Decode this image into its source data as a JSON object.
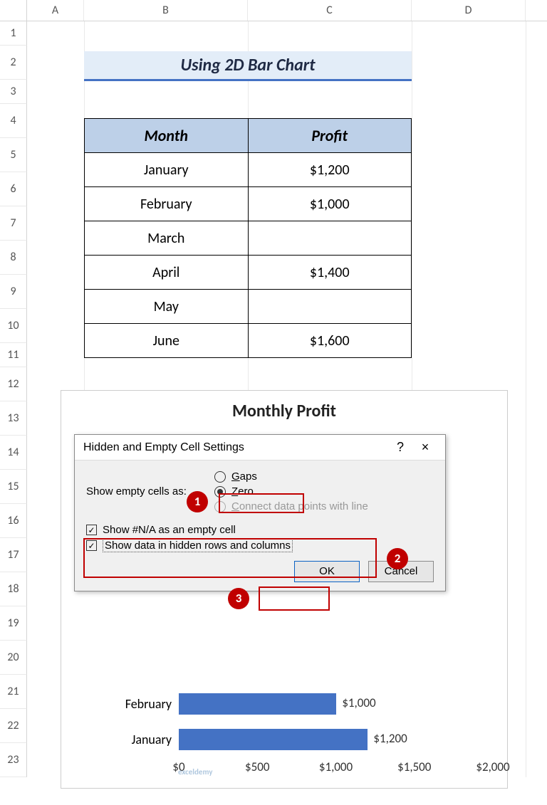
{
  "columns": [
    "A",
    "B",
    "C",
    "D"
  ],
  "rows": [
    "1",
    "2",
    "3",
    "4",
    "5",
    "6",
    "7",
    "8",
    "9",
    "10",
    "11",
    "12",
    "13",
    "14",
    "15",
    "16",
    "17",
    "18",
    "19",
    "20",
    "21",
    "22",
    "23"
  ],
  "title": "Using 2D Bar Chart",
  "table": {
    "headers": [
      "Month",
      "Profit"
    ],
    "rows": [
      {
        "month": "January",
        "profit": "$1,200"
      },
      {
        "month": "February",
        "profit": "$1,000"
      },
      {
        "month": "March",
        "profit": ""
      },
      {
        "month": "April",
        "profit": "$1,400"
      },
      {
        "month": "May",
        "profit": ""
      },
      {
        "month": "June",
        "profit": "$1,600"
      }
    ]
  },
  "chart": {
    "title": "Monthly Profit",
    "bars": [
      {
        "label": "February",
        "valueText": "$1,000",
        "pct": 50
      },
      {
        "label": "January",
        "valueText": "$1,200",
        "pct": 60
      }
    ],
    "xTicks": [
      "$0",
      "$500",
      "$1,000",
      "$1,500",
      "$2,000"
    ]
  },
  "chart_data": {
    "type": "bar",
    "orientation": "horizontal",
    "title": "Monthly Profit",
    "categories": [
      "January",
      "February",
      "March",
      "April",
      "May",
      "June"
    ],
    "values": [
      1200,
      1000,
      null,
      1400,
      null,
      1600
    ],
    "visible_categories": [
      "January",
      "February"
    ],
    "visible_values": [
      1200,
      1000
    ],
    "xlabel": "",
    "ylabel": "",
    "xlim": [
      0,
      2000
    ],
    "xTicks": [
      0,
      500,
      1000,
      1500,
      2000
    ]
  },
  "dialog": {
    "title": "Hidden and Empty Cell Settings",
    "help": "?",
    "close": "×",
    "showEmptyLabel": "Show empty cells as:",
    "opt_gaps": "Gaps",
    "opt_zero": "Zero",
    "opt_connect": "Connect data points with line",
    "chk_na": "Show #N/A as an empty cell",
    "chk_hidden": "Show data in hidden rows and columns",
    "ok": "OK",
    "cancel": "Cancel"
  },
  "annot": {
    "one": "1",
    "two": "2",
    "three": "3"
  },
  "watermark": "exceldemy"
}
